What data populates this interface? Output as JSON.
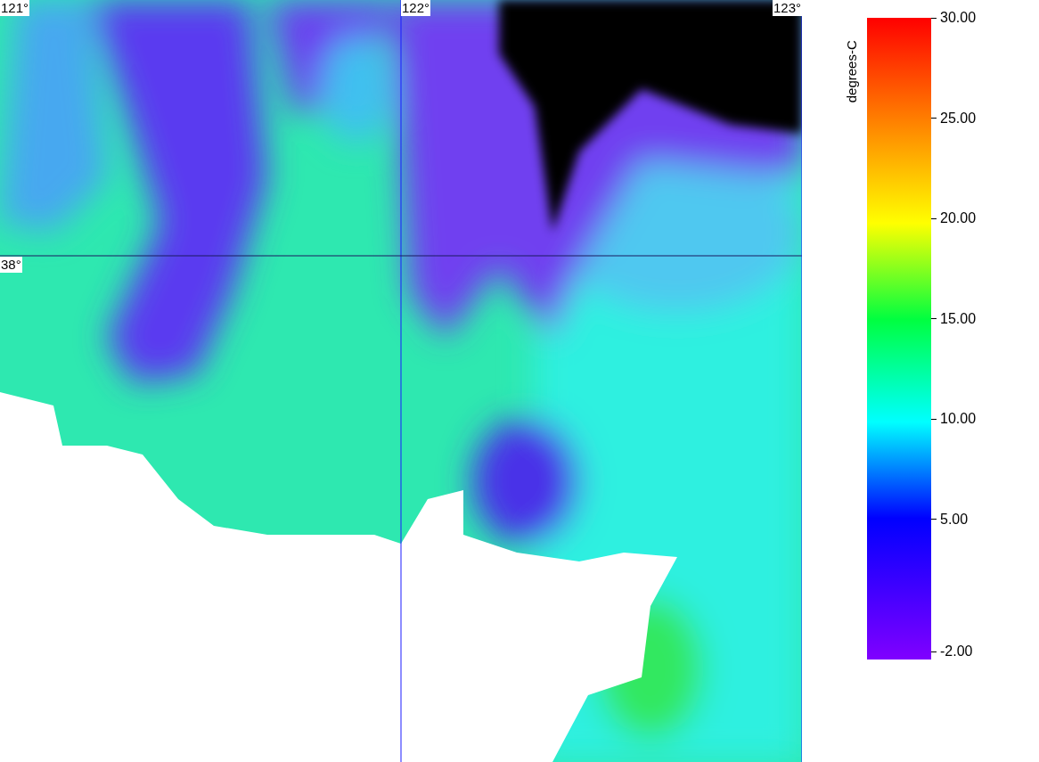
{
  "map": {
    "longitude_labels": [
      "121°",
      "122°",
      "123°"
    ],
    "latitude_labels": [
      "38°"
    ]
  },
  "colorbar": {
    "unit": "degrees-C",
    "ticks": [
      "30.00",
      "25.00",
      "20.00",
      "15.00",
      "10.00",
      "5.00",
      "-2.00"
    ]
  }
}
